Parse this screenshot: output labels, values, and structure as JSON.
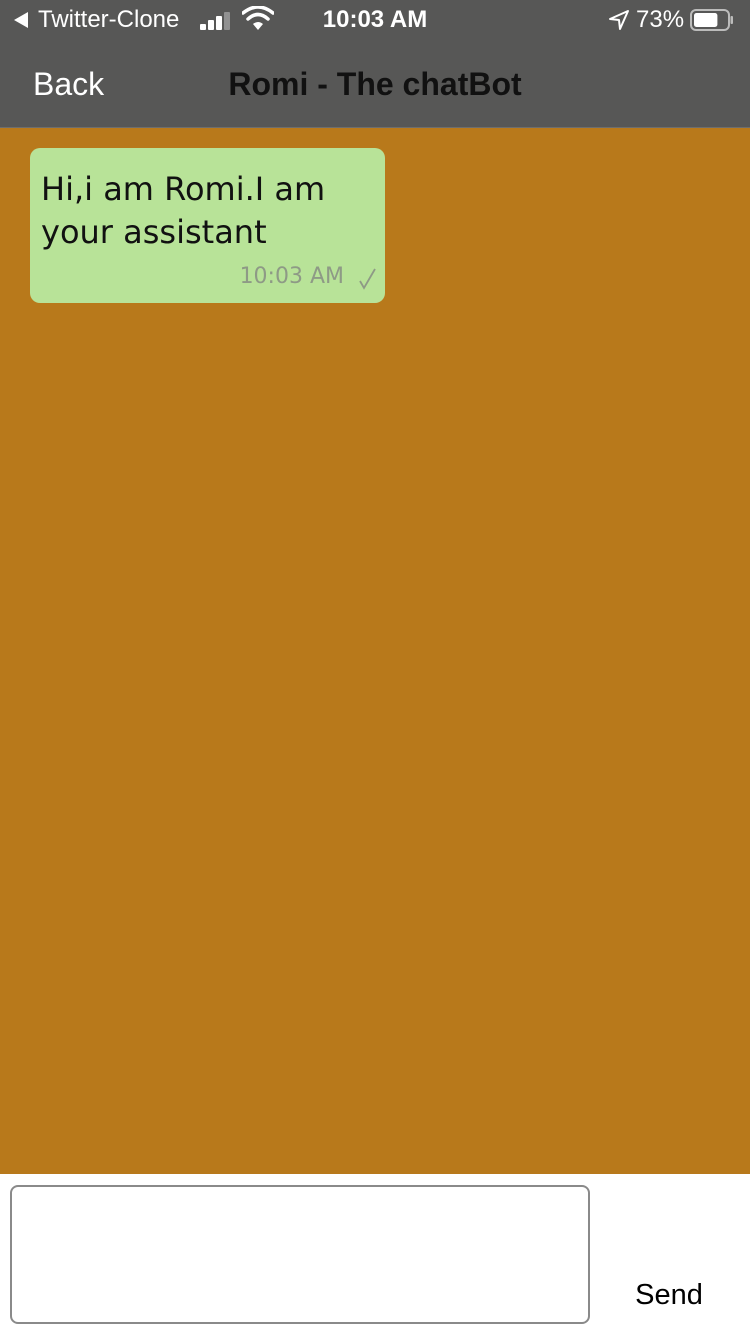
{
  "status_bar": {
    "back_app_label": "Twitter-Clone",
    "time": "10:03 AM",
    "battery_percent": "73%",
    "battery_level": 0.73,
    "signal_bars_active": 3,
    "signal_bars_total": 4
  },
  "nav": {
    "back_label": "Back",
    "title": "Romi - The chatBot"
  },
  "messages": [
    {
      "text": "Hi,i am Romi.I am your assistant",
      "time": "10:03 AM",
      "status": "√"
    }
  ],
  "composer": {
    "value": "",
    "placeholder": "",
    "send_label": "Send"
  },
  "colors": {
    "nav_background": "#575756",
    "chat_background": "#b8791b",
    "bubble_background": "#b8e398"
  }
}
